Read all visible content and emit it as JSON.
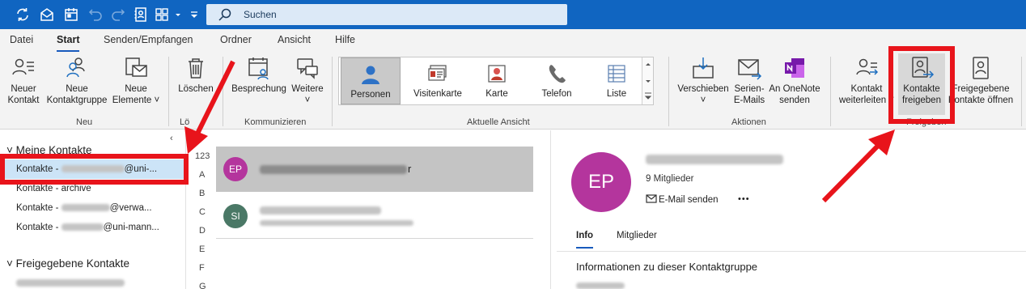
{
  "quick_access": {
    "icons": [
      "sync-icon",
      "envelope-open-icon",
      "calendar-icon",
      "undo-icon",
      "redo-icon",
      "address-book-icon",
      "grid-icon",
      "dropdown-icon"
    ]
  },
  "search": {
    "placeholder": "Suchen"
  },
  "menu": {
    "tabs": [
      "Datei",
      "Start",
      "Senden/Empfangen",
      "Ordner",
      "Ansicht",
      "Hilfe"
    ],
    "active": "Start"
  },
  "ribbon": {
    "neu": {
      "label": "Neu",
      "new_contact": [
        "Neuer",
        "Kontakt"
      ],
      "new_group": [
        "Neue",
        "Kontaktgruppe"
      ],
      "new_items": [
        "Neue",
        "Elemente ˅"
      ]
    },
    "loeschen": {
      "label": "Lö",
      "delete": "Löschen"
    },
    "kommunizieren": {
      "label": "Kommunizieren",
      "meeting": "Besprechung",
      "more": [
        "Weitere",
        "˅"
      ]
    },
    "ansicht": {
      "label": "Aktuelle Ansicht",
      "items": [
        "Personen",
        "Visitenkarte",
        "Karte",
        "Telefon",
        "Liste"
      ],
      "selected": "Personen"
    },
    "aktionen": {
      "label": "Aktionen",
      "move": [
        "Verschieben",
        "˅"
      ],
      "mailmerge": [
        "Serien-",
        "E-Mails"
      ],
      "onenote": [
        "An OneNote",
        "senden"
      ]
    },
    "freigeben": {
      "label": "Freigeben",
      "forward": [
        "Kontakt",
        "weiterleiten ˅"
      ],
      "share": [
        "Kontakte",
        "freigeben"
      ],
      "open_shared": [
        "Freigegebene",
        "Kontakte öffnen"
      ]
    }
  },
  "nav": {
    "my_contacts_header": "Meine Kontakte",
    "items": [
      {
        "label": "Kontakte - ",
        "suffix": "@uni-..."
      },
      {
        "label": "Kontakte - archive",
        "suffix": ""
      },
      {
        "label": "Kontakte - ",
        "suffix": "@verwa..."
      },
      {
        "label": "Kontakte - ",
        "suffix": "@uni-mann..."
      }
    ],
    "shared_header": "Freigegebene Kontakte"
  },
  "alpha_index": [
    "123",
    "A",
    "B",
    "C",
    "D",
    "E",
    "F",
    "G"
  ],
  "contacts": [
    {
      "initials": "EP",
      "name_tail": "r",
      "color": "#b4359d"
    },
    {
      "initials": "SI",
      "color": "#4a7866"
    }
  ],
  "detail": {
    "initials": "EP",
    "members_count": "9 Mitglieder",
    "send_email": "E-Mail senden",
    "more": "•••",
    "tabs": [
      "Info",
      "Mitglieder"
    ],
    "active_tab": "Info",
    "section_title": "Informationen zu dieser Kontaktgruppe"
  },
  "colors": {
    "titlebar": "#1065c1",
    "accent": "#185abd",
    "annotation_red": "#e8141b"
  }
}
